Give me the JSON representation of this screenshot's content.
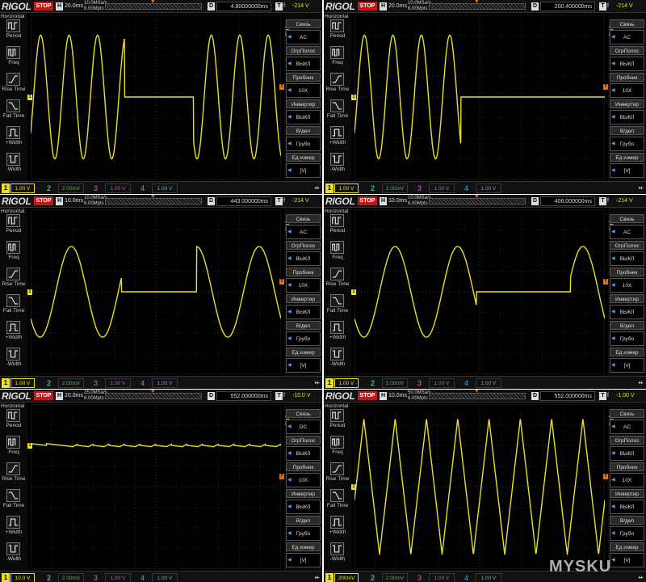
{
  "common": {
    "brand": "RIGOL",
    "stop_label": "STOP",
    "h_icon": "H",
    "d_icon": "D",
    "t_icon": "T",
    "trigger_slope": "f",
    "left_sidebar": {
      "title": "Horizontal",
      "items": [
        "Period",
        "Freq",
        "Rise Time",
        "Fall Time",
        "+Width",
        "-Width"
      ]
    },
    "right_sidebar": {
      "channel": "CH1",
      "labels": [
        "Связь",
        "ОгрПолос",
        "Пробник",
        "Инвертир",
        "В/дел",
        "Ед измер"
      ]
    },
    "ch_numbers": [
      "1",
      "2",
      "3",
      "4"
    ],
    "ch_other_values": [
      "2.00mV",
      "1.00 V",
      "1.00 V"
    ],
    "usb_glyph": "⇷",
    "colors": {
      "ch1": "#e8e02a",
      "ch2": "#38c080",
      "ch3": "#c050c0",
      "ch4": "#3a9ae0",
      "trigger": "#e07020",
      "stop": "#c01818",
      "grid": "#444444"
    }
  },
  "panels": [
    {
      "timebase": "20.0ms",
      "sample_rate": "10.0MSa/s\n6.00Mpts",
      "delay": "4.80000000ms",
      "trig_level": "-214 V",
      "ch1_scale": "1.00 V",
      "menu_values": [
        "AC",
        "ВЫКЛ",
        "10X",
        "ВЫКЛ",
        "Грубо",
        "[V]"
      ],
      "chart_data": {
        "type": "line",
        "waveform": "sine with dropout gap",
        "freq_hz": 55,
        "amplitude_div": 3.0,
        "offset_div": 0.0,
        "gap_ms": [
          40,
          84
        ],
        "gap_level_div": 0.0,
        "xlim_ms": [
          -20,
          140
        ],
        "ylim_div": [
          -4,
          4
        ]
      }
    },
    {
      "timebase": "20.0ms",
      "sample_rate": "10.0MSa/s\n6.00Mpts",
      "delay": "200.400000ms",
      "trig_level": "-214 V",
      "ch1_scale": "1.00 V",
      "menu_values": [
        "AC",
        "ВЫКЛ",
        "10X",
        "ВЫКЛ",
        "Грубо",
        "[V]"
      ],
      "chart_data": {
        "type": "line",
        "waveform": "sine with dropout gap",
        "freq_hz": 55,
        "amplitude_div": 3.0,
        "offset_div": 0.0,
        "gap_ms": [
          48,
          140
        ],
        "gap_level_div": 0.0,
        "xlim_ms": [
          -20,
          140
        ],
        "ylim_div": [
          -4,
          4
        ]
      }
    },
    {
      "timebase": "10.0ms",
      "sample_rate": "10.0MSa/s\n6.00Mpts",
      "delay": "443.000000ms",
      "trig_level": "-214 V",
      "ch1_scale": "1.00 V",
      "menu_values": [
        "AC",
        "ВЫКЛ",
        "10X",
        "ВЫКЛ",
        "Грубо",
        "[V]"
      ],
      "chart_data": {
        "type": "line",
        "waveform": "sine with dropout gap",
        "freq_hz": 50,
        "amplitude_div": 2.2,
        "offset_div": 0.0,
        "gap_ms": [
          21,
          45
        ],
        "gap_level_div": 0.0,
        "xlim_ms": [
          -8,
          72
        ],
        "ylim_div": [
          -4,
          4
        ]
      }
    },
    {
      "timebase": "10.0ms",
      "sample_rate": "10.0MSa/s\n6.00Mpts",
      "delay": "406.000000ms",
      "trig_level": "-214 V",
      "ch1_scale": "1.00 V",
      "menu_values": [
        "AC",
        "ВЫКЛ",
        "10X",
        "ВЫКЛ",
        "Грубо",
        "[V]"
      ],
      "chart_data": {
        "type": "line",
        "waveform": "sine with dropout gap",
        "freq_hz": 50,
        "amplitude_div": 2.2,
        "offset_div": 0.0,
        "gap_ms": [
          31,
          61
        ],
        "gap_level_div": 0.0,
        "xlim_ms": [
          -8,
          72
        ],
        "ylim_div": [
          -4,
          4
        ]
      }
    },
    {
      "timebase": "20.0ms",
      "sample_rate": "25.0MSa/s\n6.00Mpts",
      "delay": "552.000000ms",
      "trig_level": "-10.0 V",
      "ch1_scale": "10.0 V",
      "menu_values": [
        "DC",
        "ВЫКЛ",
        "10X",
        "ВЫКЛ",
        "Грубо",
        "[V]"
      ],
      "chart_data": {
        "type": "line",
        "waveform": "dc with ripple",
        "freq_hz": 100,
        "amplitude_div": 0.12,
        "offset_div": 2.0,
        "xlim_ms": [
          -20,
          140
        ],
        "ylim_div": [
          -4,
          4
        ]
      }
    },
    {
      "timebase": "10.0ms",
      "sample_rate": "50.0MSa/s\n6.00Mpts",
      "delay": "552.000000ms",
      "trig_level": "-1.00 V",
      "ch1_scale": "200mV",
      "menu_values": [
        "AC",
        "ВЫКЛ",
        "10X",
        "ВЫКЛ",
        "Грубо",
        "[V]"
      ],
      "chart_data": {
        "type": "line",
        "waveform": "triangle",
        "freq_hz": 100,
        "amplitude_div": 3.3,
        "offset_div": 0.0,
        "xlim_ms": [
          -8,
          72
        ],
        "ylim_div": [
          -4,
          4
        ]
      }
    }
  ],
  "watermark": "MYSKU"
}
